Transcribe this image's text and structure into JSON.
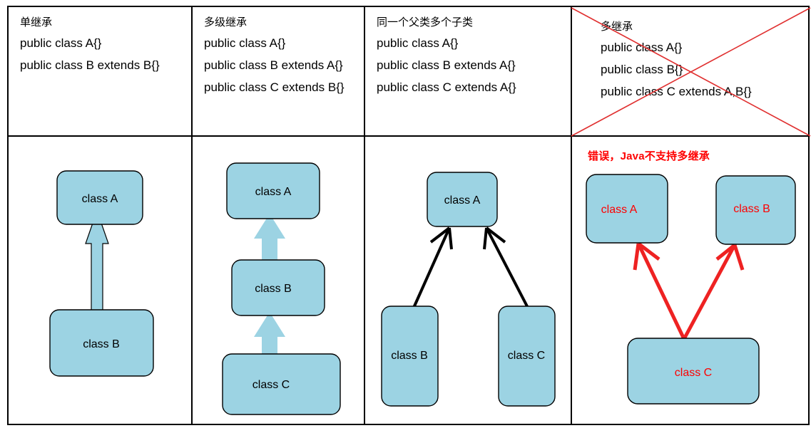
{
  "diagram": {
    "title": "Java inheritance types comparison table",
    "colors": {
      "box_fill": "#9CD3E3",
      "box_stroke": "#000000",
      "blue_arrow": "#9CD3E3",
      "black_arrow": "#000000",
      "red": "#FE0000",
      "red_x": "#E03030",
      "grid": "#000000",
      "background": "#FFFFFF"
    },
    "columns": [
      {
        "id": "single-inheritance",
        "title": "单继承",
        "code": [
          "public class A{}",
          "public class B extends B{}"
        ],
        "warning": "",
        "invalid": false,
        "arrow_style": "hollow-block",
        "nodes": [
          {
            "label": "class A",
            "role": "parent"
          },
          {
            "label": "class B",
            "role": "child"
          }
        ],
        "edges": [
          {
            "from": "class B",
            "to": "class A"
          }
        ]
      },
      {
        "id": "multilevel-inheritance",
        "title": "多级继承",
        "code": [
          "public class A{}",
          "public class B extends A{}",
          "public class C extends B{}"
        ],
        "warning": "",
        "invalid": false,
        "arrow_style": "filled-blue-block",
        "nodes": [
          {
            "label": "class A",
            "role": "grandparent"
          },
          {
            "label": "class B",
            "role": "parent"
          },
          {
            "label": "class C",
            "role": "child"
          }
        ],
        "edges": [
          {
            "from": "class B",
            "to": "class A"
          },
          {
            "from": "class C",
            "to": "class B"
          }
        ]
      },
      {
        "id": "one-parent-many-children",
        "title": "同一个父类多个子类",
        "code": [
          "public class A{}",
          "public class B extends A{}",
          "public class C extends A{}"
        ],
        "warning": "",
        "invalid": false,
        "arrow_style": "black-line",
        "nodes": [
          {
            "label": "class A",
            "role": "parent"
          },
          {
            "label": "class B",
            "role": "child"
          },
          {
            "label": "class C",
            "role": "child"
          }
        ],
        "edges": [
          {
            "from": "class B",
            "to": "class A"
          },
          {
            "from": "class C",
            "to": "class A"
          }
        ]
      },
      {
        "id": "multiple-inheritance",
        "title": "多继承",
        "code": [
          "public class A{}",
          "public class B{}",
          "public class C extends A,B{}"
        ],
        "warning": "错误，Java不支持多继承",
        "invalid": true,
        "arrow_style": "red-line",
        "nodes": [
          {
            "label": "class A",
            "role": "parent"
          },
          {
            "label": "class B",
            "role": "parent"
          },
          {
            "label": "class C",
            "role": "child"
          }
        ],
        "edges": [
          {
            "from": "class C",
            "to": "class A"
          },
          {
            "from": "class C",
            "to": "class B"
          }
        ]
      }
    ]
  }
}
